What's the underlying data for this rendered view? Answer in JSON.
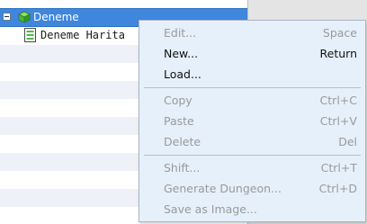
{
  "tree": {
    "root": {
      "label": "Deneme",
      "expanded": true,
      "selected": true,
      "icon": "cube-icon"
    },
    "child": {
      "label": "Deneme Harita",
      "icon": "map-document-icon"
    }
  },
  "context_menu": {
    "groups": [
      [
        {
          "label": "Edit...",
          "accelerator": "Space",
          "enabled": false
        },
        {
          "label": "New...",
          "accelerator": "Return",
          "enabled": true
        },
        {
          "label": "Load...",
          "accelerator": "",
          "enabled": true
        }
      ],
      [
        {
          "label": "Copy",
          "accelerator": "Ctrl+C",
          "enabled": false
        },
        {
          "label": "Paste",
          "accelerator": "Ctrl+V",
          "enabled": false
        },
        {
          "label": "Delete",
          "accelerator": "Del",
          "enabled": false
        }
      ],
      [
        {
          "label": "Shift...",
          "accelerator": "Ctrl+T",
          "enabled": false
        },
        {
          "label": "Generate Dungeon...",
          "accelerator": "Ctrl+D",
          "enabled": false
        },
        {
          "label": "Save as Image...",
          "accelerator": "",
          "enabled": false
        }
      ]
    ]
  },
  "colors": {
    "selection": "#3f86dd",
    "menu_background": "#e6f0fb",
    "disabled_text": "#9a9a9a",
    "stripe": "#eef2f8"
  }
}
